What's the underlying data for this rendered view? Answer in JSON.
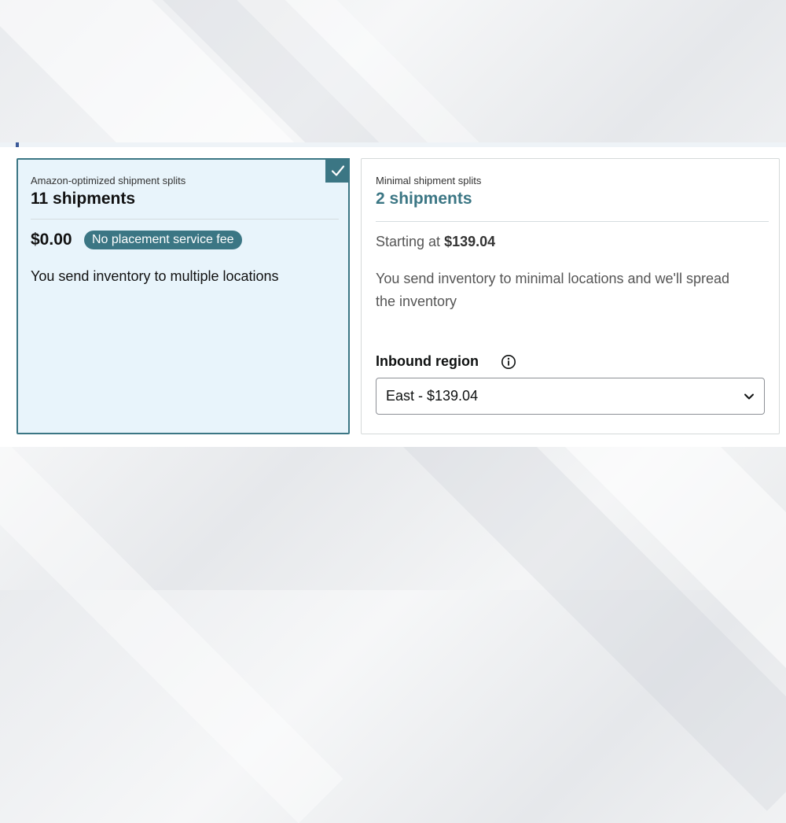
{
  "option_amazon": {
    "subtitle": "Amazon-optimized shipment splits",
    "count": "11 shipments",
    "price": "$0.00",
    "badge": "No placement service fee",
    "description": "You send inventory to multiple locations",
    "selected": true
  },
  "option_minimal": {
    "subtitle": "Minimal shipment splits",
    "count": "2 shipments",
    "starting_label": "Starting at",
    "starting_price": "$139.04",
    "description": "You send inventory to minimal locations and we'll spread the inventory",
    "region_label": "Inbound region",
    "region_value": "East - $139.04"
  },
  "icons": {
    "selected": "checkmark-icon",
    "info": "info-icon",
    "dropdown": "chevron-down-icon"
  },
  "colors": {
    "accent": "#3b7684",
    "selected_bg": "#e8f4fb"
  }
}
